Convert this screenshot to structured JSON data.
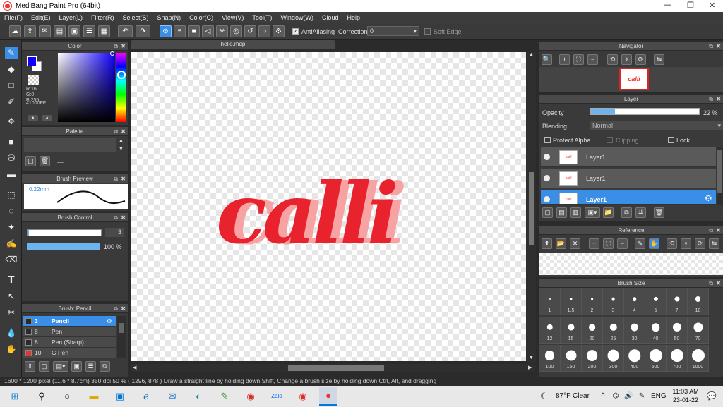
{
  "window": {
    "title": "MediBang Paint Pro (64bit)"
  },
  "menu": [
    "File(F)",
    "Edit(E)",
    "Layer(L)",
    "Filter(R)",
    "Select(S)",
    "Snap(N)",
    "Color(C)",
    "View(V)",
    "Tool(T)",
    "Window(W)",
    "Cloud",
    "Help"
  ],
  "toolbar": {
    "antialiasing_label": "AntiAliasing",
    "correction_label": "Correction",
    "correction_value": "0",
    "soft_edge_label": "Soft Edge"
  },
  "color_panel": {
    "title": "Color",
    "r": "R:16",
    "g": "G:0",
    "b": "B:255",
    "hex": "#1000FF",
    "primary": "#1000FF",
    "secondary": "#ffffff"
  },
  "palette_panel": {
    "title": "Palette",
    "value": "---"
  },
  "brush_preview": {
    "title": "Brush Preview",
    "size": "0.22mm"
  },
  "brush_control": {
    "title": "Brush Control",
    "size_value": "3",
    "opacity_value": "100 %",
    "opacity_fraction": 1.0
  },
  "brush_list": {
    "title": "Brush: Pencil",
    "items": [
      {
        "size": "3",
        "name": "Pencil",
        "color": "#2a2a2a"
      },
      {
        "size": "8",
        "name": "Pen",
        "color": "#2a2a2a"
      },
      {
        "size": "8",
        "name": "Pen (Sharp)",
        "color": "#2a2a2a"
      },
      {
        "size": "10",
        "name": "G Pen",
        "color": "#e33333"
      }
    ]
  },
  "document": {
    "tab": "hello.mdp",
    "art_text": "calli"
  },
  "navigator": {
    "title": "Navigator",
    "thumb_text": "calli"
  },
  "layer_panel": {
    "title": "Layer",
    "opacity_label": "Opacity",
    "opacity_value": "22 %",
    "opacity_fraction": 0.22,
    "blending_label": "Blending",
    "blending_value": "Normal",
    "protect_alpha": "Protect Alpha",
    "clipping": "Clipping",
    "lock": "Lock",
    "layers": [
      {
        "name": "Layer1",
        "thumb": "calli"
      },
      {
        "name": "Layer1",
        "thumb": "calli"
      },
      {
        "name": "Layer1",
        "thumb": "calli"
      }
    ]
  },
  "reference_panel": {
    "title": "Reference"
  },
  "brush_size_panel": {
    "title": "Brush Size",
    "sizes": [
      "1",
      "1.5",
      "2",
      "3",
      "4",
      "5",
      "7",
      "10",
      "12",
      "15",
      "20",
      "25",
      "30",
      "40",
      "50",
      "70",
      "100",
      "150",
      "200",
      "300",
      "400",
      "500",
      "700",
      "1000"
    ]
  },
  "status": {
    "text": "1600 * 1200 pixel  (11.6 * 8.7cm)  350 dpi  50 %  ( 1296, 878 )  Draw a straight line by holding down Shift, Change a brush size by holding down Ctrl, Alt, and dragging"
  },
  "taskbar": {
    "weather": "87°F  Clear",
    "lang": "ENG",
    "time": "11:03 AM",
    "date": "23-01-22"
  }
}
